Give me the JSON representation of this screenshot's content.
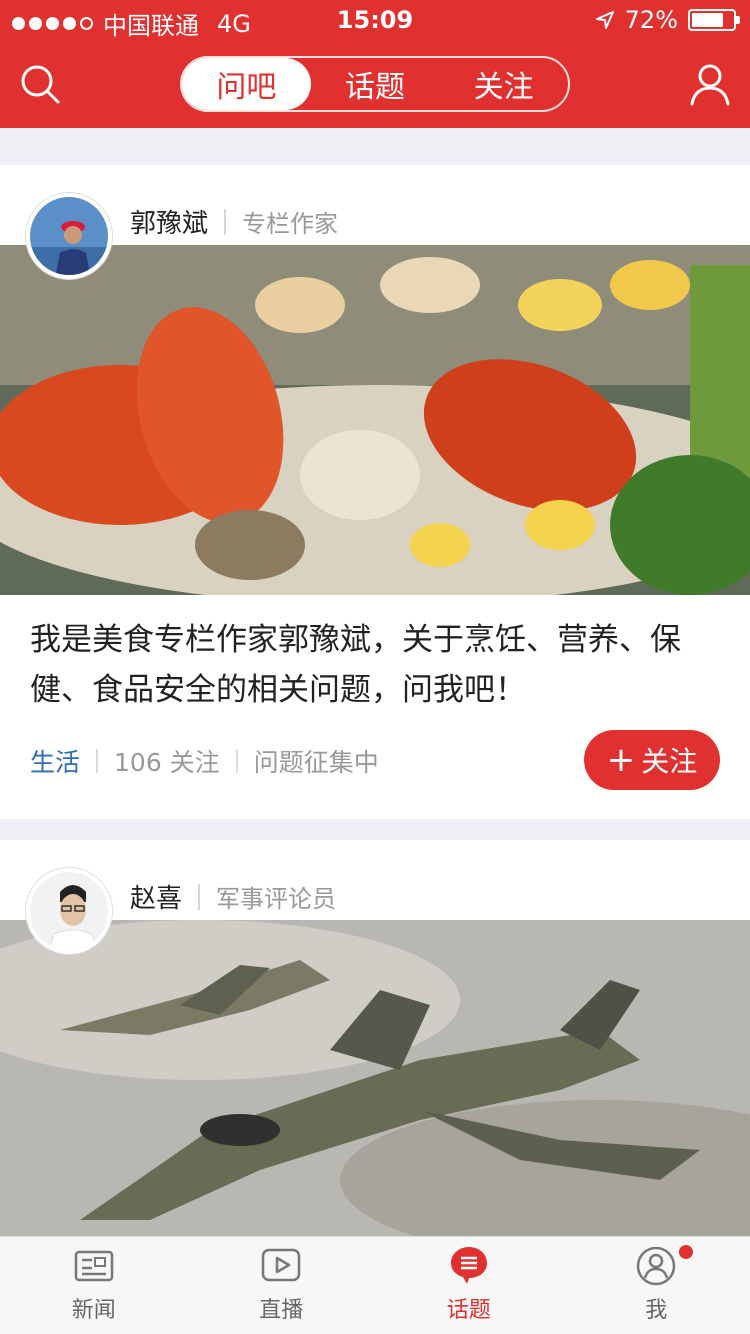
{
  "status_bar": {
    "carrier": "中国联通",
    "network": "4G",
    "time": "15:09",
    "battery": "72%"
  },
  "header": {
    "tabs": [
      {
        "label": "问吧",
        "active": true
      },
      {
        "label": "话题",
        "active": false
      },
      {
        "label": "关注",
        "active": false
      }
    ],
    "accent_color": "#e0302f"
  },
  "cards": [
    {
      "author": "郭豫斌",
      "role": "专栏作家",
      "title": "我是美食专栏作家郭豫斌，关于烹饪、营养、保健、食品安全的相关问题，问我吧！",
      "category": "生活",
      "followers": "106 关注",
      "status": "问题征集中",
      "follow_label": "关注"
    },
    {
      "author": "赵喜",
      "role": "军事评论员"
    }
  ],
  "tabbar": {
    "items": [
      {
        "label": "新闻",
        "icon": "news-icon"
      },
      {
        "label": "直播",
        "icon": "play-icon"
      },
      {
        "label": "话题",
        "icon": "topic-icon",
        "active": true
      },
      {
        "label": "我",
        "icon": "profile-icon",
        "badge": true
      }
    ]
  }
}
